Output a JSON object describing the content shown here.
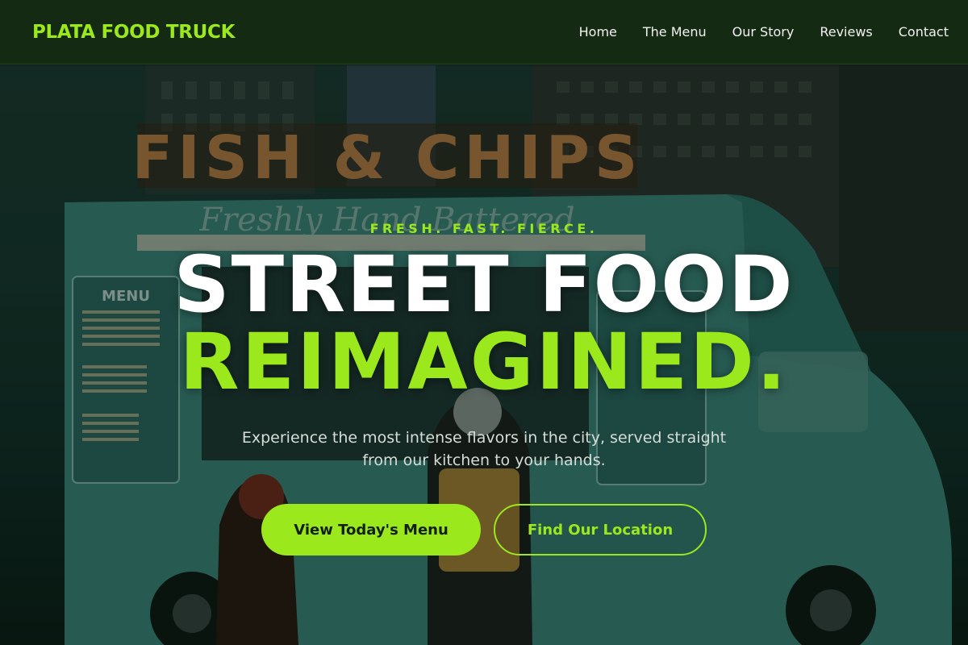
{
  "brand": {
    "name": "PLATA FOOD TRUCK"
  },
  "nav": {
    "items": [
      "Home",
      "The Menu",
      "Our Story",
      "Reviews",
      "Contact"
    ]
  },
  "hero": {
    "tagline": "FRESH. FAST. FIERCE.",
    "headline_line1": "STREET FOOD",
    "headline_line2": "REIMAGINED.",
    "subtext": "Experience the most intense flavors in the city, served straight from our kitchen to your hands.",
    "primary_button": "View Today's Menu",
    "secondary_button": "Find Our Location",
    "photo_sign_text": "FISH & CHIPS",
    "photo_script_text": "Freshly Hand Battered",
    "photo_menu_title": "MENU"
  },
  "colors": {
    "accent": "#9be81c",
    "nav_bg": "#142a12",
    "truck_teal": "#3f8f87"
  }
}
